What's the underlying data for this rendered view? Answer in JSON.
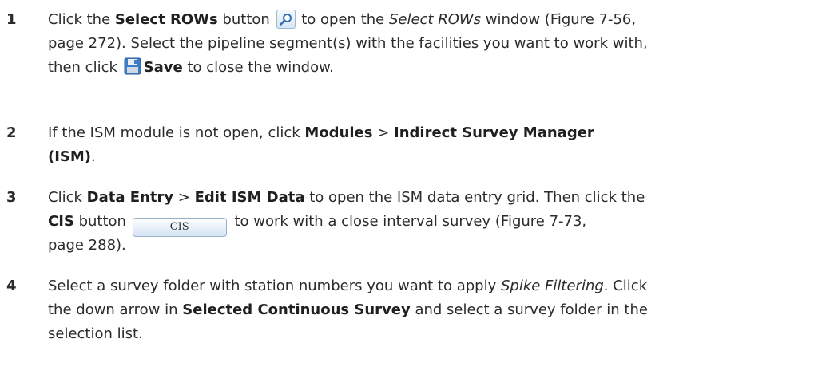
{
  "steps": [
    {
      "number": "1",
      "l1_a": "Click the ",
      "l1_b": "Select ROWs",
      "l1_c": " button ",
      "l1_d": " to open the ",
      "l1_e": "Select ROWs",
      "l1_f": " window (Figure 7-56,",
      "l2": "page 272). Select the pipeline segment(s) with the facilities you want to work with,",
      "l3_a": "then click ",
      "l3_b": "Save",
      "l3_c": " to close the window."
    },
    {
      "number": "2",
      "l1_a": "If the ISM module is not open, click ",
      "l1_b": "Modules",
      "l1_c": " > ",
      "l1_d": "Indirect Survey Manager",
      "l2": "(ISM)",
      "l2_end": "."
    },
    {
      "number": "3",
      "l1_a": "Click ",
      "l1_b": "Data Entry",
      "l1_c": " > ",
      "l1_d": "Edit ISM Data",
      "l1_e": " to open the ISM data entry grid. Then click the",
      "l2_a": "CIS",
      "l2_b": " button ",
      "l2_btn": "CIS",
      "l2_c": " to work with a close interval survey (Figure 7-73,",
      "l3": "page 288)."
    },
    {
      "number": "4",
      "l1_a": "Select a survey folder with station numbers you want to apply ",
      "l1_b": "Spike Filtering",
      "l1_c": ". Click",
      "l2_a": "the down arrow in ",
      "l2_b": "Selected Continuous Survey",
      "l2_c": " and select a survey folder in the",
      "l3": "selection list."
    }
  ],
  "icons": {
    "search": "magnifier-icon",
    "save": "floppy-disk-icon"
  },
  "colors": {
    "text": "#2b2b2b",
    "button_border": "#9ab0c8",
    "icon_blue": "#2f6fb8"
  }
}
